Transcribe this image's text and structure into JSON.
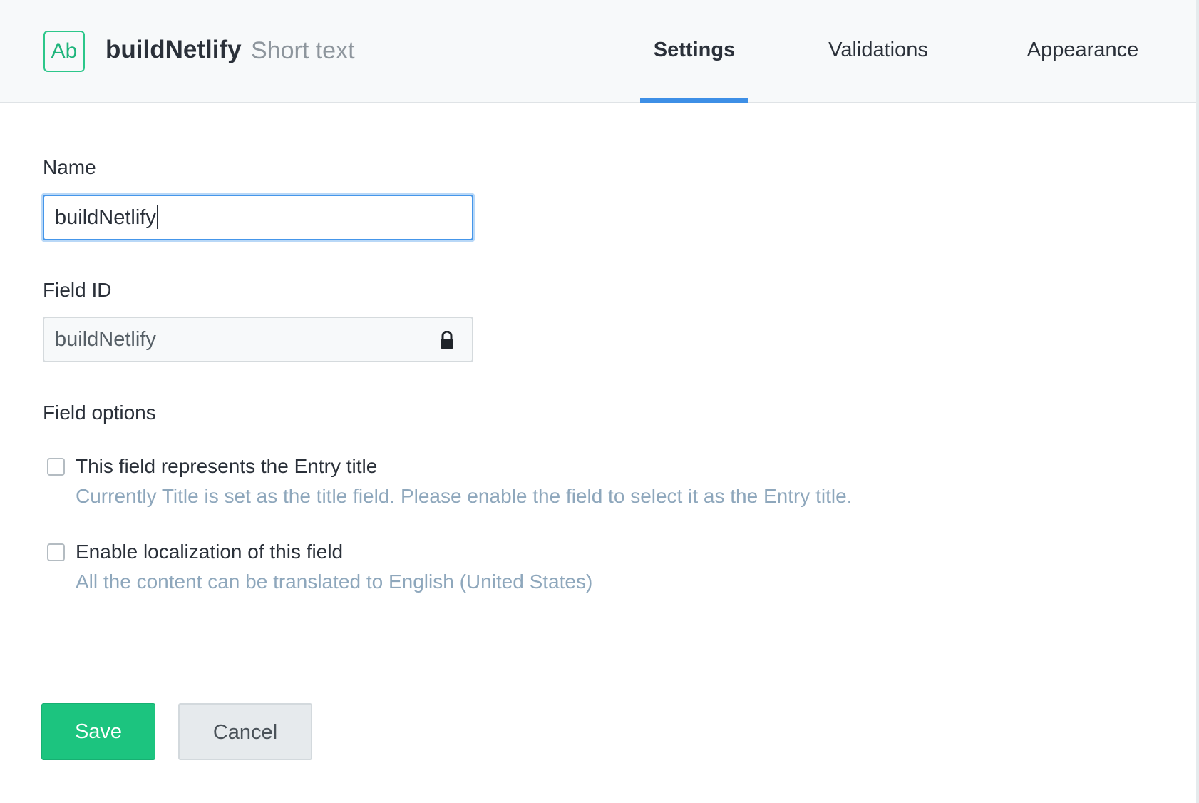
{
  "header": {
    "type_icon_text": "Ab",
    "field_name": "buildNetlify",
    "field_type": "Short text",
    "tabs": [
      {
        "label": "Settings",
        "active": true
      },
      {
        "label": "Validations",
        "active": false
      },
      {
        "label": "Appearance",
        "active": false
      }
    ]
  },
  "form": {
    "name_label": "Name",
    "name_value": "buildNetlify",
    "field_id_label": "Field ID",
    "field_id_value": "buildNetlify",
    "field_options_label": "Field options",
    "options": [
      {
        "label": "This field represents the Entry title",
        "help": "Currently Title is set as the title field. Please enable the field to select it as the Entry title.",
        "checked": false
      },
      {
        "label": "Enable localization of this field",
        "help": "All the content can be translated to English (United States)",
        "checked": false
      }
    ]
  },
  "actions": {
    "save_label": "Save",
    "cancel_label": "Cancel"
  },
  "colors": {
    "accent_green": "#1cc47f",
    "tab_underline": "#3d8fe6",
    "focus_blue": "#4596ea",
    "help_text": "#8ea7bc"
  },
  "icons": {
    "type_icon": "short-text-type-icon",
    "lock": "lock-icon"
  }
}
